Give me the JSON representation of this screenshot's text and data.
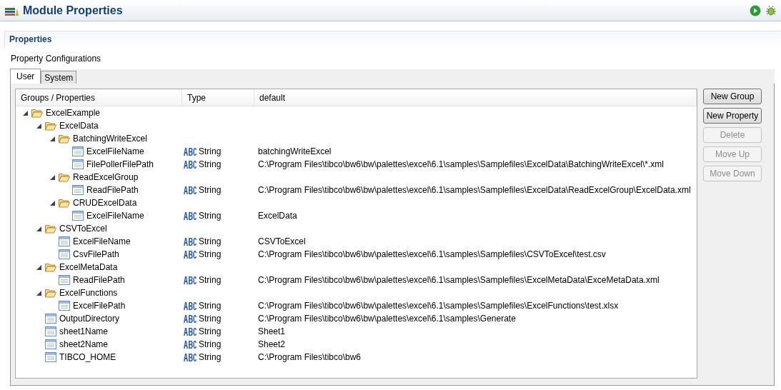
{
  "window": {
    "title": "Module Properties"
  },
  "section": {
    "title": "Properties",
    "subtitle": "Property Configurations"
  },
  "tabs": [
    {
      "label": "User",
      "selected": true
    },
    {
      "label": "System",
      "selected": false
    }
  ],
  "table": {
    "columns": [
      "Groups / Properties",
      "Type",
      "default"
    ],
    "rows": [
      {
        "label": "ExcelExample",
        "kind": "group",
        "expanded": true,
        "children": [
          {
            "label": "ExcelData",
            "kind": "group",
            "expanded": true,
            "children": [
              {
                "label": "BatchingWriteExcel",
                "kind": "group",
                "expanded": true,
                "children": [
                  {
                    "label": "ExcelFileName",
                    "kind": "property",
                    "type": "String",
                    "default": "batchingWriteExcel"
                  },
                  {
                    "label": "FilePollerFilePath",
                    "kind": "property",
                    "type": "String",
                    "default": "C:\\Program Files\\tibco\\bw6\\bw\\palettes\\excel\\6.1\\samples\\Samplefiles\\ExcelData\\BatchingWriteExcel\\*.xml"
                  }
                ]
              },
              {
                "label": "ReadExcelGroup",
                "kind": "group",
                "expanded": true,
                "children": [
                  {
                    "label": "ReadFilePath",
                    "kind": "property",
                    "type": "String",
                    "default": "C:\\Program Files\\tibco\\bw6\\bw\\palettes\\excel\\6.1\\samples\\Samplefiles\\ExcelData\\ReadExcelGroup\\ExcelData.xml"
                  }
                ]
              },
              {
                "label": "CRUDExcelData",
                "kind": "group",
                "expanded": true,
                "children": [
                  {
                    "label": "ExcelFileName",
                    "kind": "property",
                    "type": "String",
                    "default": "ExcelData"
                  }
                ]
              }
            ]
          },
          {
            "label": "CSVToExcel",
            "kind": "group",
            "expanded": true,
            "children": [
              {
                "label": "ExcelFileName",
                "kind": "property",
                "type": "String",
                "default": "CSVToExcel"
              },
              {
                "label": "CsvFilePath",
                "kind": "property",
                "type": "String",
                "default": "C:\\Program Files\\tibco\\bw6\\bw\\palettes\\excel\\6.1\\samples\\Samplefiles\\CSVToExcel\\test.csv"
              }
            ]
          },
          {
            "label": "ExcelMetaData",
            "kind": "group",
            "expanded": true,
            "children": [
              {
                "label": "ReadFilePath",
                "kind": "property",
                "type": "String",
                "default": "C:\\Program Files\\tibco\\bw6\\bw\\palettes\\excel\\6.1\\samples\\Samplefiles\\ExcelMetaData\\ExceMetaData.xml"
              }
            ]
          },
          {
            "label": "ExcelFunctions",
            "kind": "group",
            "expanded": true,
            "children": [
              {
                "label": "ExcelFilePath",
                "kind": "property",
                "type": "String",
                "default": "C:\\Program Files\\tibco\\bw6\\bw\\palettes\\excel\\6.1\\samples\\Samplefiles\\ExcelFunctions\\test.xlsx"
              }
            ]
          },
          {
            "label": "OutputDirectory",
            "kind": "property",
            "type": "String",
            "default": "C:\\Program Files\\tibco\\bw6\\bw\\palettes\\excel\\6.1\\samples\\Generate"
          },
          {
            "label": "sheet1Name",
            "kind": "property",
            "type": "String",
            "default": "Sheet1"
          },
          {
            "label": "sheet2Name",
            "kind": "property",
            "type": "String",
            "default": "Sheet2"
          },
          {
            "label": "TIBCO_HOME",
            "kind": "property",
            "type": "String",
            "default": "C:\\Program Files\\tibco\\bw6"
          }
        ]
      }
    ]
  },
  "buttons": [
    {
      "label": "New Group",
      "disabled": false
    },
    {
      "label": "New Property",
      "disabled": false
    },
    {
      "label": "Delete",
      "disabled": true
    },
    {
      "label": "Move Up",
      "disabled": true
    },
    {
      "label": "Move Down",
      "disabled": true
    }
  ]
}
